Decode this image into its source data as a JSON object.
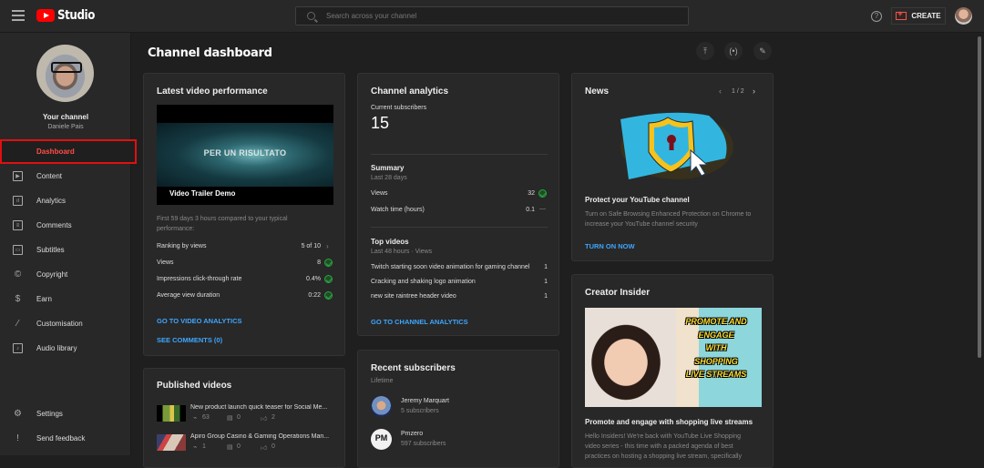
{
  "topbar": {
    "app_name": "Studio",
    "search_placeholder": "Search across your channel",
    "create_label": "CREATE",
    "help_symbol": "?"
  },
  "sidebar": {
    "channel_title": "Your channel",
    "channel_name": "Daniele Pais",
    "items": [
      {
        "label": "Dashboard",
        "icon": "dashboard-icon",
        "active": true
      },
      {
        "label": "Content",
        "icon": "content-icon"
      },
      {
        "label": "Analytics",
        "icon": "analytics-icon"
      },
      {
        "label": "Comments",
        "icon": "comments-icon"
      },
      {
        "label": "Subtitles",
        "icon": "subtitles-icon"
      },
      {
        "label": "Copyright",
        "icon": "copyright-icon"
      },
      {
        "label": "Earn",
        "icon": "dollar-icon"
      },
      {
        "label": "Customisation",
        "icon": "magic-wand-icon"
      },
      {
        "label": "Audio library",
        "icon": "audio-library-icon"
      }
    ],
    "bottom_items": [
      {
        "label": "Settings",
        "icon": "gear-icon"
      },
      {
        "label": "Send feedback",
        "icon": "feedback-icon"
      }
    ]
  },
  "main": {
    "title": "Channel dashboard",
    "header_actions": [
      "upload-icon",
      "go-live-icon",
      "create-post-icon"
    ]
  },
  "latest_video": {
    "title": "Latest video performance",
    "thumbnail_text": "PER UN RISULTATO",
    "video_title": "Video Trailer Demo",
    "comparison_text_1": "First 59 days 3 hours compared to your typical",
    "comparison_text_2": "performance:",
    "metrics": [
      {
        "label": "Ranking by views",
        "value": "5 of 10",
        "indicator": "chevron"
      },
      {
        "label": "Views",
        "value": "8",
        "indicator": "check"
      },
      {
        "label": "Impressions click-through rate",
        "value": "0.4%",
        "indicator": "check"
      },
      {
        "label": "Average view duration",
        "value": "0:22",
        "indicator": "check"
      }
    ],
    "link_analytics": "GO TO VIDEO ANALYTICS",
    "link_comments": "SEE COMMENTS (0)"
  },
  "published_videos": {
    "title": "Published videos",
    "items": [
      {
        "title": "New product launch quick teaser for Social Me...",
        "views": "63",
        "comments": "0",
        "likes": "2"
      },
      {
        "title": "Apiro Group Casino & Gaming Operations Man...",
        "views": "1",
        "comments": "0",
        "likes": "0"
      }
    ]
  },
  "channel_analytics": {
    "title": "Channel analytics",
    "subscribers_label": "Current subscribers",
    "subscribers_value": "15",
    "summary_title": "Summary",
    "summary_period": "Last 28 days",
    "summary_rows": [
      {
        "label": "Views",
        "value": "32",
        "indicator": "check"
      },
      {
        "label": "Watch time (hours)",
        "value": "0.1",
        "indicator": "dash"
      }
    ],
    "top_videos_title": "Top videos",
    "top_videos_period": "Last 48 hours · Views",
    "top_videos": [
      {
        "title": "Twitch starting soon video animation for gaming channel",
        "views": "1"
      },
      {
        "title": "Cracking and shaking logo animation",
        "views": "1"
      },
      {
        "title": "new site raintree header video",
        "views": "1"
      }
    ],
    "link": "GO TO CHANNEL ANALYTICS"
  },
  "recent_subscribers": {
    "title": "Recent subscribers",
    "period": "Lifetime",
    "items": [
      {
        "name": "Jeremy Marquart",
        "subs": "5 subscribers"
      },
      {
        "name": "Pmzero",
        "subs": "597 subscribers"
      }
    ]
  },
  "news": {
    "title": "News",
    "pager": "1 / 2",
    "headline": "Protect your YouTube channel",
    "body_1": "Turn on Safe Browsing Enhanced Protection on Chrome to",
    "body_2": "increase your YouTube channel security",
    "cta": "TURN ON NOW"
  },
  "creator_insider": {
    "title": "Creator Insider",
    "thumb_lines": [
      "PROMOTE AND",
      "ENGAGE",
      "WITH",
      "SHOPPING",
      "LIVE STREAMS"
    ],
    "headline": "Promote and engage with shopping live streams",
    "body_1": "Hello Insiders! We're back with YouTube Live Shopping",
    "body_2": "video series - this time with a packed agenda of best",
    "body_3": "practices on hosting a shopping live stream, specifically"
  },
  "colors": {
    "accent_red": "#ff4e45",
    "link_blue": "#3ea6ff",
    "success_green": "#2ba640",
    "card_bg": "#282828",
    "page_bg": "#1f1f1f"
  }
}
